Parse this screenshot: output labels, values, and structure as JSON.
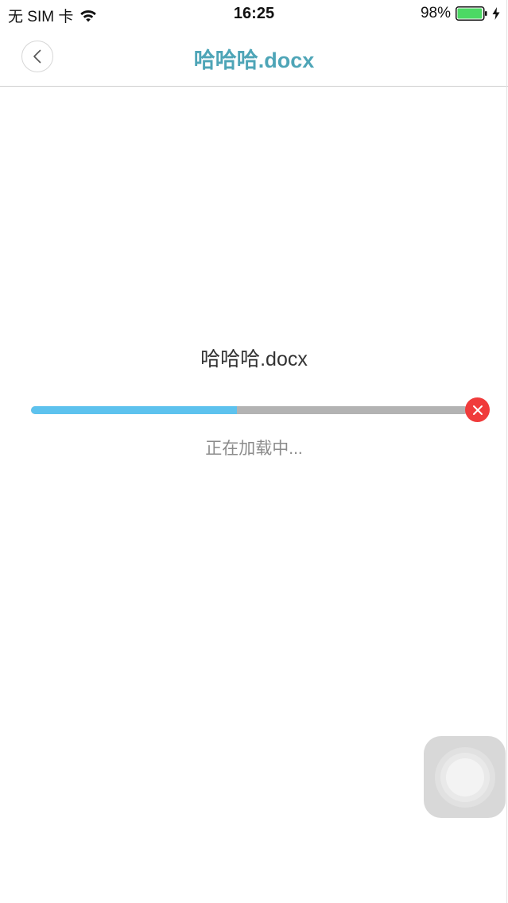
{
  "status_bar": {
    "carrier": "无 SIM 卡",
    "time": "16:25",
    "battery_percent": "98%",
    "battery_level": 0.98,
    "battery_color": "#4cd964",
    "icons": [
      "wifi-icon",
      "battery-icon",
      "charging-bolt-icon"
    ]
  },
  "nav": {
    "title": "哈哈哈.docx",
    "back_icon": "chevron-left-icon",
    "title_color": "#4ea5b7"
  },
  "loading": {
    "file_name": "哈哈哈.docx",
    "progress": 0.47,
    "progress_color": "#5dc2ee",
    "track_color": "#b3b3b3",
    "cancel_icon": "close-icon",
    "cancel_color": "#f03b3b",
    "status_text": "正在加载中..."
  },
  "assistive_touch": {
    "icon": "assistive-touch-icon"
  }
}
